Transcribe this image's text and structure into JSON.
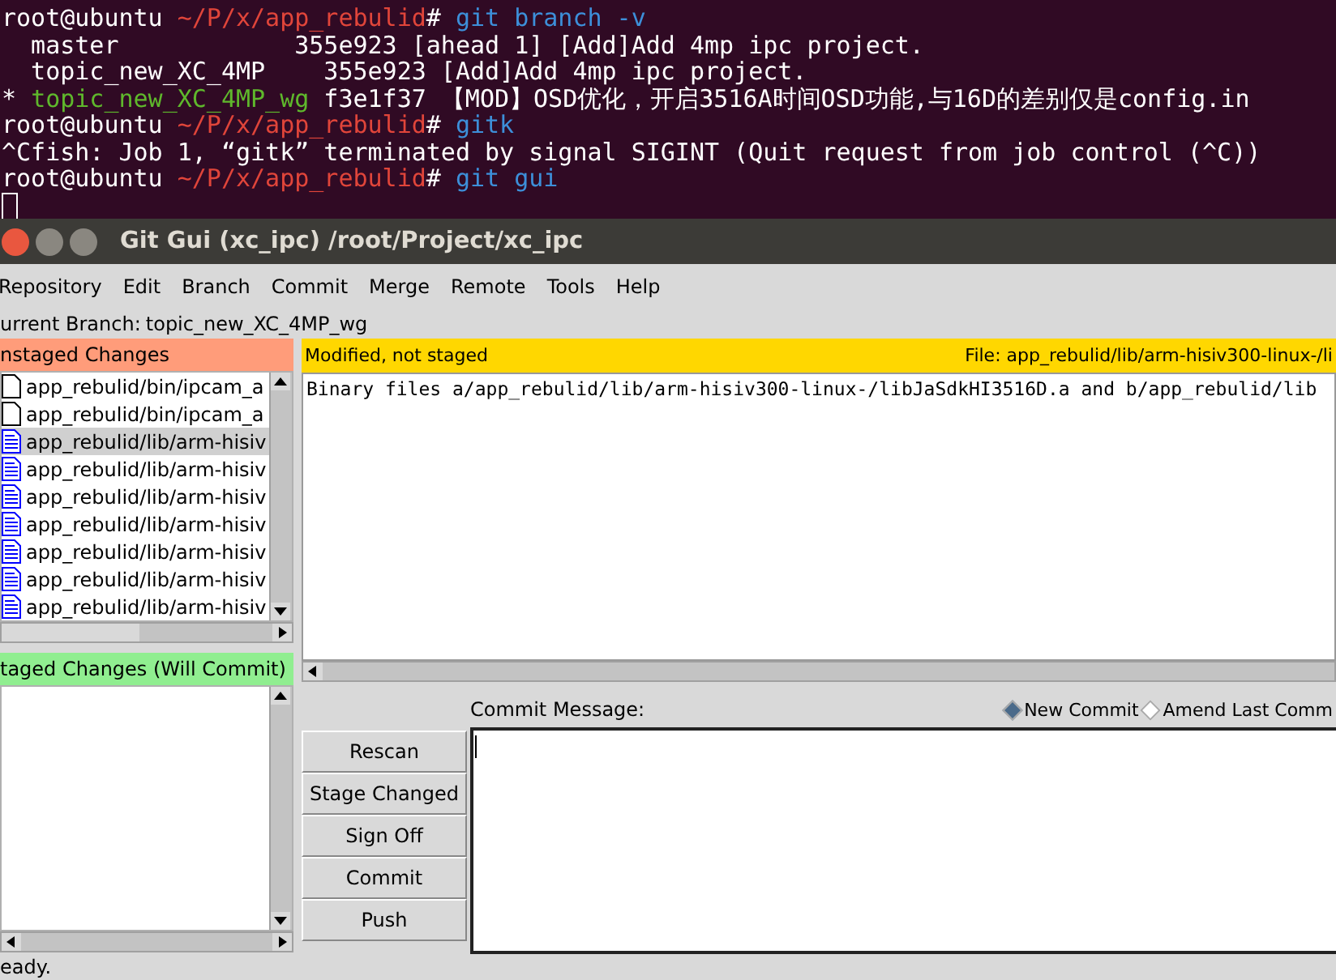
{
  "terminal": {
    "lines": [
      [
        {
          "kind": "prompt",
          "text": "root@ubuntu"
        },
        {
          "kind": "path",
          "text": " ~/P/x/app_rebulid"
        },
        {
          "kind": "prompt",
          "text": "#"
        },
        {
          "kind": "command",
          "text": " git branch -v"
        }
      ],
      [
        {
          "kind": "plain",
          "text": "  master            355e923 [ahead 1] [Add]Add 4mp ipc project."
        }
      ],
      [
        {
          "kind": "plain",
          "text": "  topic_new_XC_4MP    355e923 [Add]Add 4mp ipc project."
        }
      ],
      [
        {
          "kind": "plain",
          "text": "* "
        },
        {
          "kind": "current",
          "text": "topic_new_XC_4MP_wg"
        },
        {
          "kind": "plain",
          "text": " f3e1f37 【MOD】OSD优化，开启3516A时间OSD功能,与16D的差别仅是config.in"
        }
      ],
      [
        {
          "kind": "prompt",
          "text": "root@ubuntu"
        },
        {
          "kind": "path",
          "text": " ~/P/x/app_rebulid"
        },
        {
          "kind": "prompt",
          "text": "#"
        },
        {
          "kind": "command",
          "text": " gitk"
        }
      ],
      [
        {
          "kind": "plain",
          "text": "^Cfish: Job 1, “gitk” terminated by signal SIGINT (Quit request from job control (^C))"
        }
      ],
      [
        {
          "kind": "prompt",
          "text": "root@ubuntu"
        },
        {
          "kind": "path",
          "text": " ~/P/x/app_rebulid"
        },
        {
          "kind": "prompt",
          "text": "#"
        },
        {
          "kind": "command",
          "text": " git gui"
        }
      ]
    ]
  },
  "window": {
    "title": "Git Gui (xc_ipc) /root/Project/xc_ipc",
    "menu": [
      "Repository",
      "Edit",
      "Branch",
      "Commit",
      "Merge",
      "Remote",
      "Tools",
      "Help"
    ],
    "branch_label": "urrent Branch:",
    "branch": "topic_new_XC_4MP_wg",
    "unstaged": {
      "title": "nstaged Changes",
      "files": [
        {
          "kind": "untracked",
          "path": "app_rebulid/bin/ipcam_a",
          "selected": false
        },
        {
          "kind": "untracked",
          "path": "app_rebulid/bin/ipcam_a",
          "selected": false
        },
        {
          "kind": "modified",
          "path": "app_rebulid/lib/arm-hisiv",
          "selected": true
        },
        {
          "kind": "modified",
          "path": "app_rebulid/lib/arm-hisiv",
          "selected": false
        },
        {
          "kind": "modified",
          "path": "app_rebulid/lib/arm-hisiv",
          "selected": false
        },
        {
          "kind": "modified",
          "path": "app_rebulid/lib/arm-hisiv",
          "selected": false
        },
        {
          "kind": "modified",
          "path": "app_rebulid/lib/arm-hisiv",
          "selected": false
        },
        {
          "kind": "modified",
          "path": "app_rebulid/lib/arm-hisiv",
          "selected": false
        },
        {
          "kind": "modified",
          "path": "app_rebulid/lib/arm-hisiv",
          "selected": false
        }
      ]
    },
    "staged": {
      "title": "taged Changes (Will Commit)"
    },
    "diff": {
      "status": "Modified, not staged",
      "file": "File: app_rebulid/lib/arm-hisiv300-linux-/li",
      "lines": [
        "Binary files a/app_rebulid/lib/arm-hisiv300-linux-/libJaSdkHI3516D.a and b/app_rebulid/lib"
      ]
    },
    "commit": {
      "label": "Commit Message:",
      "modes": [
        {
          "label": "New Commit",
          "selected": true
        },
        {
          "label": "Amend Last Comm",
          "selected": false
        }
      ],
      "buttons": [
        "Rescan",
        "Stage Changed",
        "Sign Off",
        "Commit",
        "Push"
      ]
    },
    "status": "eady."
  }
}
